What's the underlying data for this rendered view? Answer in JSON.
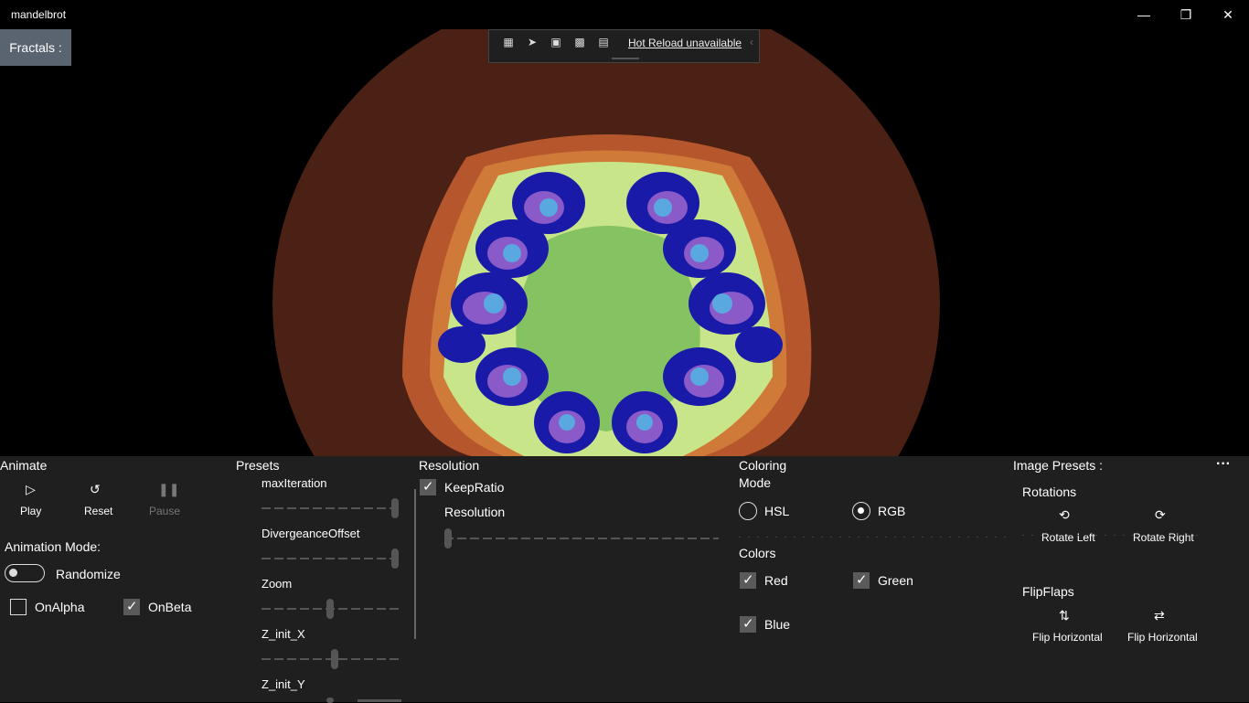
{
  "window": {
    "title": "mandelbrot"
  },
  "topbar": {
    "fractals_label": "Fractals :"
  },
  "hotreload": {
    "label": "Hot Reload unavailable"
  },
  "animate": {
    "header": "Animate",
    "play": "Play",
    "reset": "Reset",
    "pause": "Pause",
    "mode_label": "Animation Mode:",
    "randomize": "Randomize",
    "on_alpha": "OnAlpha",
    "on_beta": "OnBeta"
  },
  "presets": {
    "header": "Presets",
    "sliders": [
      {
        "label": "maxIteration",
        "value": 1.0
      },
      {
        "label": "DivergeanceOffset",
        "value": 1.0
      },
      {
        "label": "Zoom",
        "value": 0.5
      },
      {
        "label": "Z_init_X",
        "value": 0.53
      },
      {
        "label": "Z_init_Y",
        "value": 0.5
      }
    ]
  },
  "resolution": {
    "header": "Resolution",
    "keep_ratio": "KeepRatio",
    "label": "Resolution",
    "value": 0.0
  },
  "coloring": {
    "header_line1": "Coloring",
    "header_line2": "Mode",
    "hsl": "HSL",
    "rgb": "RGB",
    "colors_label": "Colors",
    "red": "Red",
    "green": "Green",
    "blue": "Blue"
  },
  "image_presets": {
    "header": "Image Presets :",
    "more": "···",
    "rotations": "Rotations",
    "rotate_left": "Rotate Left",
    "rotate_right": "Rotate Right",
    "flipflaps": "FlipFlaps",
    "flip_horizontal_1": "Flip Horizontal",
    "flip_horizontal_2": "Flip Horizontal"
  },
  "colors": {
    "outer_brown": "#4a2114",
    "mid_orange": "#b5562d",
    "light_green": "#c8e58a",
    "center_green": "#84c262",
    "dark_blue": "#1a1aa8",
    "light_blue": "#5aa8e0",
    "purple": "#8a5ac8"
  }
}
